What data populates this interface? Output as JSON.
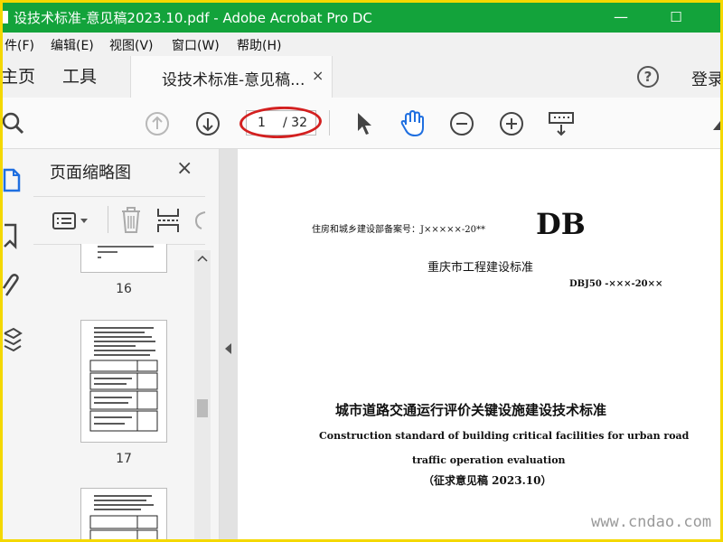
{
  "window": {
    "title": "设技术标准-意见稿2023.10.pdf - Adobe Acrobat Pro DC",
    "minimize_glyph": "—",
    "maximize_glyph": "☐"
  },
  "menu": [
    "件(F)",
    "编辑(E)",
    "视图(V)",
    "窗口(W)",
    "帮助(H)"
  ],
  "tabs": {
    "home": "主页",
    "tools": "工具",
    "document": "设技术标准-意见稿...",
    "close_glyph": "×",
    "help_glyph": "?",
    "login": "登录"
  },
  "toolbar": {
    "page_current": "1",
    "page_total": "/ 32",
    "icons": [
      "search-icon",
      "page-up-icon",
      "page-down-icon",
      "select-arrow-icon",
      "hand-icon",
      "zoom-out-icon",
      "zoom-in-icon",
      "keyboard-icon"
    ]
  },
  "panel": {
    "title": "页面缩略图",
    "close_glyph": "×",
    "thumbnails": [
      {
        "page": "16"
      },
      {
        "page": "17"
      }
    ]
  },
  "document": {
    "record_line": "住房和城乡建设部备案号：J×××××-20**",
    "db_logo": "DB",
    "issuer": "重庆市工程建设标准",
    "std_code": "DBJ50 -×××-20××",
    "title_cn": "城市道路交通运行评价关键设施建设技术标准",
    "title_en_1": "Construction standard of building critical facilities for urban road",
    "title_en_2": "traffic operation evaluation",
    "draft_note": "（征求意见稿 2023.10）"
  },
  "watermark": "www.cndao.com",
  "colors": {
    "titlebar": "#13a33b",
    "highlight_ellipse": "#d32020",
    "frame_border": "#f4d800"
  }
}
